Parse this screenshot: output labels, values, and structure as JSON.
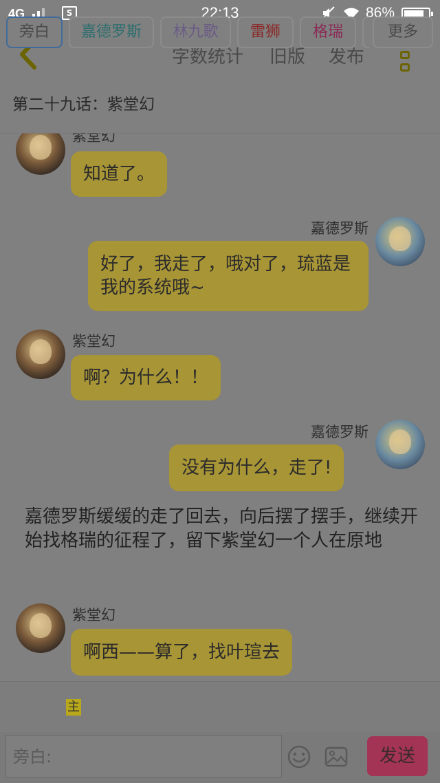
{
  "status_bar": {
    "network": "4G",
    "time": "22:13",
    "battery_percent": "86%",
    "icons": [
      "signal-icon",
      "sim-icon",
      "mute-icon",
      "wifi-icon",
      "battery-icon"
    ]
  },
  "header": {
    "back_icon": "chevron-left-icon",
    "word_count_label": "字数统计",
    "old_version_label": "旧版",
    "publish_label": "发布",
    "menu_icon": "more-vertical-icon"
  },
  "chapter_title": "第二十九话：紫堂幻",
  "messages": [
    {
      "side": "left",
      "name": "紫堂幻",
      "text": "知道了。"
    },
    {
      "side": "right",
      "name": "嘉德罗斯",
      "text": "好了，我走了，哦对了，琉蓝是我的系统哦~"
    },
    {
      "side": "left",
      "name": "紫堂幻",
      "text": "啊？为什么！！"
    },
    {
      "side": "right",
      "name": "嘉德罗斯",
      "text": "没有为什么，走了!"
    },
    {
      "side": "narration",
      "text": "嘉德罗斯缓缓的走了回去，向后摆了摆手，继续开始找格瑞的征程了，留下紫堂幻一个人在原地"
    },
    {
      "side": "left",
      "name": "紫堂幻",
      "text": "啊西——算了，找叶瑄去"
    }
  ],
  "roles": {
    "items": [
      {
        "label": "旁白",
        "color": "#4a4a4a"
      },
      {
        "label": "嘉德罗斯",
        "color": "#2e6e6e"
      },
      {
        "label": "林九歌",
        "color": "#6a5a86"
      },
      {
        "label": "雷狮",
        "color": "#8a2a2a"
      },
      {
        "label": "格瑞",
        "color": "#8a2a55"
      }
    ],
    "host_badge": "主",
    "more_label": "更多"
  },
  "composer": {
    "placeholder": "旁白:",
    "send_label": "发送"
  },
  "colors": {
    "bubble": "#a89536",
    "send": "#a33456",
    "accent": "#6b6400"
  }
}
